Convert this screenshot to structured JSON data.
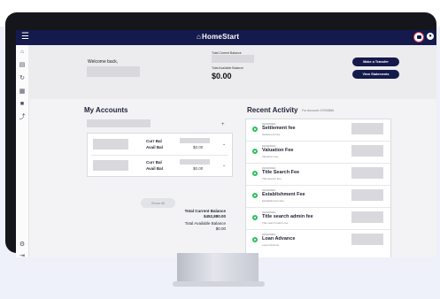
{
  "app": {
    "title": "HomeStart"
  },
  "sidebar": {
    "items": [
      "home",
      "document",
      "sync",
      "calculator",
      "folder",
      "chart",
      "settings",
      "logout"
    ]
  },
  "header": {
    "welcome": "Welcome back,",
    "total_current_label": "Total Current Balance",
    "total_available_label": "Total Available Balance",
    "total_available_value": "$0.00",
    "transfer_button": "Make a Transfer",
    "statements_button": "View Statements"
  },
  "accounts": {
    "title": "My Accounts",
    "add_icon": "+",
    "rows": [
      {
        "curr_label": "Curr Bal",
        "avail_label": "Avail Bal",
        "avail_value": "$0.00"
      },
      {
        "curr_label": "Curr Bal",
        "avail_label": "Avail Bal",
        "avail_value": "$0.00"
      }
    ],
    "show_all": "Show All",
    "total_current_label": "Total Current Balance",
    "total_current_value": "$452,880.00",
    "total_available_label": "Total Available Balance",
    "total_available_value": "$0.00"
  },
  "activity": {
    "title": "Recent Activity",
    "subtitle": "For Account: 47004866",
    "items": [
      {
        "date": "01/02/2024",
        "name": "Settlement fee",
        "sub": "Settlement Fee"
      },
      {
        "date": "01/02/2024",
        "name": "Valuation Fee",
        "sub": "Valuation Fee"
      },
      {
        "date": "01/02/2024",
        "name": "Title Search Fee",
        "sub": "Title Search Fee"
      },
      {
        "date": "01/02/2024",
        "name": "Establishment Fee",
        "sub": "Establishment Fee"
      },
      {
        "date": "01/02/2024",
        "name": "Title search admin fee",
        "sub": "Title search admin fee"
      },
      {
        "date": "01/02/2024",
        "name": "Loan Advance",
        "sub": "Loan Advance"
      }
    ]
  },
  "colors": {
    "navy": "#141a4b",
    "green": "#2fbf5e",
    "highlight": "#e53945"
  }
}
